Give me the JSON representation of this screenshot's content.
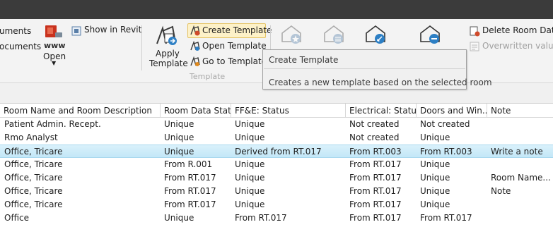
{
  "ribbon": {
    "left_partial_1": "uments",
    "left_partial_2": "ocuments",
    "open_label": "Open",
    "show_in_revit": "Show in Revit",
    "apply_template": [
      "Apply",
      "Template"
    ],
    "create_template": "Create Template",
    "open_template": "Open Template",
    "go_to_template": "Go to Template",
    "group_template": "Template",
    "delete_room_data": "Delete Room Data",
    "overwritten_values": "Overwritten values",
    "icon_www": "www"
  },
  "tooltip": {
    "title": "Create Template",
    "description": "Creates a new template based on the selected room"
  },
  "grid": {
    "columns": [
      "Room Name and Room Description",
      "Room Data Stat...",
      "FF&E: Status",
      "Electrical: Status",
      "Doors and Win...",
      "Note"
    ],
    "rows": [
      [
        "Patient Admin. Recept.",
        "Unique",
        "Unique",
        "Not created",
        "Not created",
        ""
      ],
      [
        "Rmo Analyst",
        "Unique",
        "Unique",
        "Not created",
        "Unique",
        ""
      ],
      [
        "Office, Tricare",
        "Unique",
        "Derived from RT.017",
        "From RT.003",
        "From RT.003",
        "Write a note"
      ],
      [
        "Office, Tricare",
        "From R.001",
        "Unique",
        "From RT.017",
        "Unique",
        ""
      ],
      [
        "Office, Tricare",
        "From RT.017",
        "Unique",
        "From RT.017",
        "Unique",
        "Room Name..."
      ],
      [
        "Office, Tricare",
        "From RT.017",
        "Unique",
        "From RT.017",
        "Unique",
        "Note"
      ],
      [
        "Office, Tricare",
        "From RT.017",
        "Unique",
        "From RT.017",
        "Unique",
        ""
      ],
      [
        "Office",
        "Unique",
        "From RT.017",
        "From RT.017",
        "From RT.017",
        ""
      ]
    ],
    "selected_row_index": 2
  },
  "colors": {
    "titlebar": "#3b3b3b",
    "ribbon_bg": "#f3f3f3",
    "highlight": "#fdf1c8",
    "selected_row": "#c9e9f8",
    "disabled_text": "#a0a0a0"
  }
}
